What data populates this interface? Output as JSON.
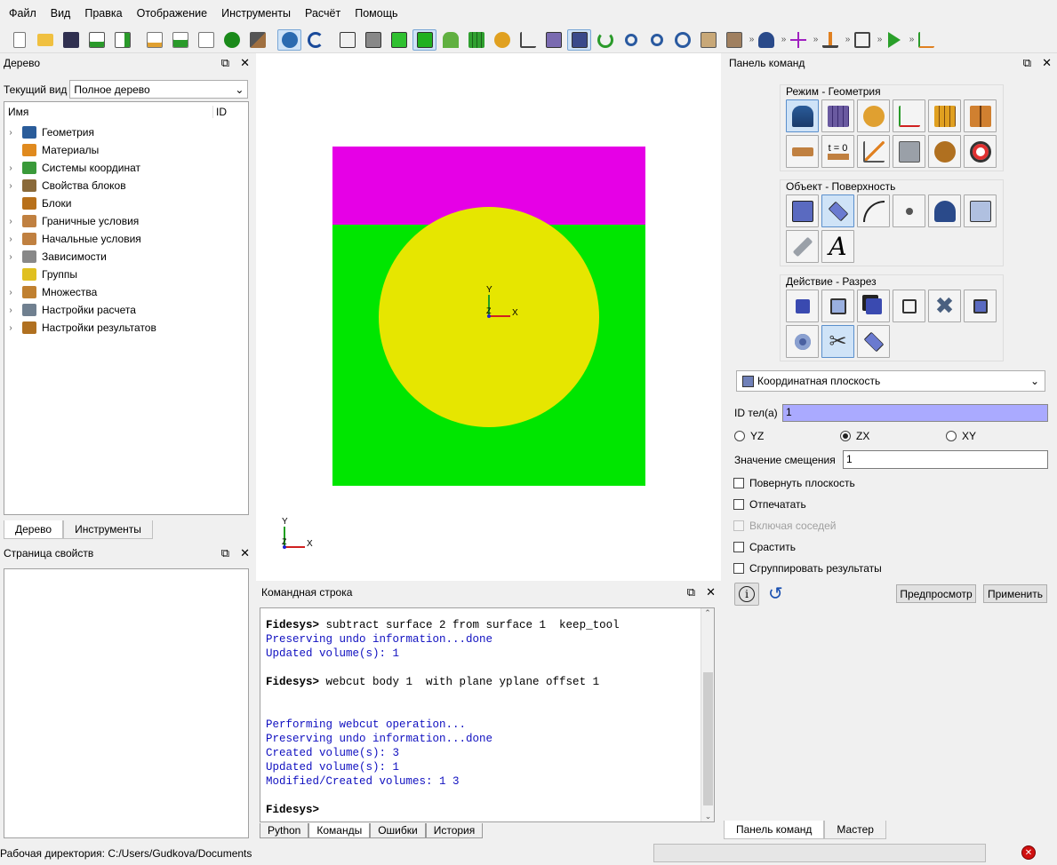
{
  "menu": [
    "Файл",
    "Вид",
    "Правка",
    "Отображение",
    "Инструменты",
    "Расчёт",
    "Помощь"
  ],
  "tree_panel": {
    "title": "Дерево",
    "view_label": "Текущий вид",
    "view_value": "Полное дерево",
    "col_name": "Имя",
    "col_id": "ID",
    "items": [
      {
        "label": "Геометрия",
        "arrow": true,
        "color": "#2a5c9a"
      },
      {
        "label": "Материалы",
        "arrow": false,
        "color": "#e08a1e"
      },
      {
        "label": "Системы координат",
        "arrow": true,
        "color": "#3a9a3a"
      },
      {
        "label": "Свойства блоков",
        "arrow": true,
        "color": "#8a6a3a"
      },
      {
        "label": "Блоки",
        "arrow": false,
        "color": "#b8701a"
      },
      {
        "label": "Граничные условия",
        "arrow": true,
        "color": "#c08040"
      },
      {
        "label": "Начальные условия",
        "arrow": true,
        "color": "#c08040"
      },
      {
        "label": "Зависимости",
        "arrow": true,
        "color": "#888888"
      },
      {
        "label": "Группы",
        "arrow": false,
        "color": "#e0c020"
      },
      {
        "label": "Множества",
        "arrow": true,
        "color": "#c08030"
      },
      {
        "label": "Настройки расчета",
        "arrow": true,
        "color": "#708090"
      },
      {
        "label": "Настройки результатов",
        "arrow": true,
        "color": "#b07020"
      }
    ],
    "tabs": [
      "Дерево",
      "Инструменты"
    ]
  },
  "props_panel": {
    "title": "Страница свойств"
  },
  "viewport": {
    "colors": {
      "magenta": "#e600e6",
      "green": "#00e600",
      "yellow": "#e6e600",
      "x_axis": "#d02020",
      "y_axis": "#20a020",
      "z_axis": "#2020d0"
    },
    "axis_labels": {
      "x": "X",
      "y": "Y",
      "z": "Z"
    }
  },
  "command_line": {
    "title": "Командная строка",
    "lines": [
      {
        "t": "prompt",
        "p": "Fidesys>",
        "c": " subtract surface 2 from surface 1  keep_tool"
      },
      {
        "t": "out",
        "c": "Preserving undo information...done"
      },
      {
        "t": "out",
        "c": "Updated volume(s): 1"
      },
      {
        "t": "blank",
        "c": ""
      },
      {
        "t": "prompt",
        "p": "Fidesys>",
        "c": " webcut body 1  with plane yplane offset 1"
      },
      {
        "t": "blank",
        "c": ""
      },
      {
        "t": "blank",
        "c": ""
      },
      {
        "t": "out",
        "c": "Performing webcut operation..."
      },
      {
        "t": "out",
        "c": "Preserving undo information...done"
      },
      {
        "t": "out",
        "c": "Created volume(s): 3"
      },
      {
        "t": "out",
        "c": "Updated volume(s): 1"
      },
      {
        "t": "out",
        "c": "Modified/Created volumes: 1 3"
      },
      {
        "t": "blank",
        "c": ""
      },
      {
        "t": "prompt",
        "p": "Fidesys>",
        "c": ""
      }
    ],
    "tabs": [
      "Python",
      "Команды",
      "Ошибки",
      "История"
    ]
  },
  "command_panel": {
    "title": "Панель команд",
    "group1_title": "Режим - Геометрия",
    "group2_title": "Объект - Поверхность",
    "group3_title": "Действие - Разрез",
    "t0_label": "t = 0",
    "text_tool_glyph": "A",
    "method_value": "Координатная плоскость",
    "body_id_label": "ID тел(а)",
    "body_id_value": "1",
    "radio_yz": "YZ",
    "radio_zx": "ZX",
    "radio_xy": "XY",
    "offset_label": "Значение смещения",
    "offset_value": "1",
    "chk_rotate": "Повернуть плоскость",
    "chk_imprint": "Отпечатать",
    "chk_neighbors": "Включая соседей",
    "chk_merge": "Срастить",
    "chk_group": "Сгруппировать результаты",
    "preview_btn": "Предпросмотр",
    "apply_btn": "Применить",
    "tabs": [
      "Панель команд",
      "Мастер"
    ]
  },
  "status": {
    "workdir": "Рабочая директория: C:/Users/Gudkova/Documents"
  }
}
